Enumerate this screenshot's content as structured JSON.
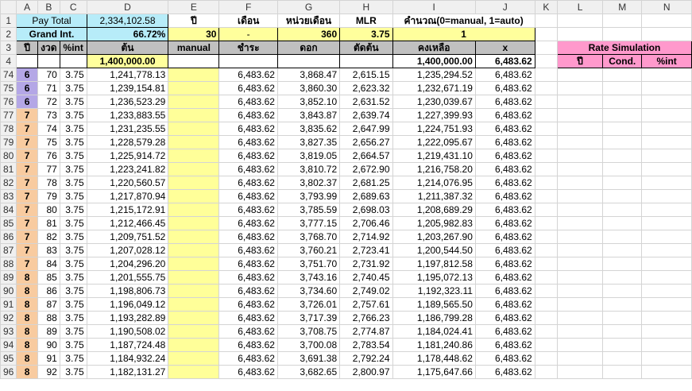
{
  "columns": [
    "A",
    "B",
    "C",
    "D",
    "E",
    "F",
    "G",
    "H",
    "I",
    "J",
    "K",
    "L",
    "M",
    "N"
  ],
  "row1": {
    "rn": "1",
    "pay_total_label": "Pay Total",
    "pay_total": "2,334,102.58",
    "e_label": "ปี",
    "f_label": "เดือน",
    "g_label": "หน่วยเดือน",
    "h_label": "MLR",
    "i_label": "คำนวณ(0=manual, 1=auto)"
  },
  "row2": {
    "rn": "2",
    "grand_int_label": "Grand Int.",
    "grand_int": "66.72%",
    "years": "30",
    "f_value": "-",
    "months": "360",
    "mlr": "3.75",
    "mode": "1"
  },
  "row3": {
    "rn": "3",
    "year": "ปี",
    "period": "งวด",
    "pint": "%int",
    "principal": "ต้น",
    "manual": "manual",
    "payment": "ชำระ",
    "interest": "ดอก",
    "deduct": "ตัดต้น",
    "balance": "คงเหลือ",
    "x": "x",
    "rate_sim": "Rate Simulation"
  },
  "row4": {
    "rn": "4",
    "principal": "1,400,000.00",
    "balance": "1,400,000.00",
    "x": "6,483.62",
    "sim_year": "ปี",
    "sim_cond": "Cond.",
    "sim_pint": "%int",
    "sim_pay": "ชำระ"
  },
  "rows": [
    {
      "rn": "74",
      "y": "6",
      "p": "70",
      "i": "3.75",
      "d": "1,241,778.13",
      "f": "6,483.62",
      "g": "3,868.47",
      "h": "2,615.15",
      "bal": "1,235,294.52",
      "x": "6,483.62"
    },
    {
      "rn": "75",
      "y": "6",
      "p": "71",
      "i": "3.75",
      "d": "1,239,154.81",
      "f": "6,483.62",
      "g": "3,860.30",
      "h": "2,623.32",
      "bal": "1,232,671.19",
      "x": "6,483.62"
    },
    {
      "rn": "76",
      "y": "6",
      "p": "72",
      "i": "3.75",
      "d": "1,236,523.29",
      "f": "6,483.62",
      "g": "3,852.10",
      "h": "2,631.52",
      "bal": "1,230,039.67",
      "x": "6,483.62"
    },
    {
      "rn": "77",
      "y": "7",
      "p": "73",
      "i": "3.75",
      "d": "1,233,883.55",
      "f": "6,483.62",
      "g": "3,843.87",
      "h": "2,639.74",
      "bal": "1,227,399.93",
      "x": "6,483.62"
    },
    {
      "rn": "78",
      "y": "7",
      "p": "74",
      "i": "3.75",
      "d": "1,231,235.55",
      "f": "6,483.62",
      "g": "3,835.62",
      "h": "2,647.99",
      "bal": "1,224,751.93",
      "x": "6,483.62"
    },
    {
      "rn": "79",
      "y": "7",
      "p": "75",
      "i": "3.75",
      "d": "1,228,579.28",
      "f": "6,483.62",
      "g": "3,827.35",
      "h": "2,656.27",
      "bal": "1,222,095.67",
      "x": "6,483.62"
    },
    {
      "rn": "80",
      "y": "7",
      "p": "76",
      "i": "3.75",
      "d": "1,225,914.72",
      "f": "6,483.62",
      "g": "3,819.05",
      "h": "2,664.57",
      "bal": "1,219,431.10",
      "x": "6,483.62"
    },
    {
      "rn": "81",
      "y": "7",
      "p": "77",
      "i": "3.75",
      "d": "1,223,241.82",
      "f": "6,483.62",
      "g": "3,810.72",
      "h": "2,672.90",
      "bal": "1,216,758.20",
      "x": "6,483.62"
    },
    {
      "rn": "82",
      "y": "7",
      "p": "78",
      "i": "3.75",
      "d": "1,220,560.57",
      "f": "6,483.62",
      "g": "3,802.37",
      "h": "2,681.25",
      "bal": "1,214,076.95",
      "x": "6,483.62"
    },
    {
      "rn": "83",
      "y": "7",
      "p": "79",
      "i": "3.75",
      "d": "1,217,870.94",
      "f": "6,483.62",
      "g": "3,793.99",
      "h": "2,689.63",
      "bal": "1,211,387.32",
      "x": "6,483.62"
    },
    {
      "rn": "84",
      "y": "7",
      "p": "80",
      "i": "3.75",
      "d": "1,215,172.91",
      "f": "6,483.62",
      "g": "3,785.59",
      "h": "2,698.03",
      "bal": "1,208,689.29",
      "x": "6,483.62"
    },
    {
      "rn": "85",
      "y": "7",
      "p": "81",
      "i": "3.75",
      "d": "1,212,466.45",
      "f": "6,483.62",
      "g": "3,777.15",
      "h": "2,706.46",
      "bal": "1,205,982.83",
      "x": "6,483.62"
    },
    {
      "rn": "86",
      "y": "7",
      "p": "82",
      "i": "3.75",
      "d": "1,209,751.52",
      "f": "6,483.62",
      "g": "3,768.70",
      "h": "2,714.92",
      "bal": "1,203,267.90",
      "x": "6,483.62"
    },
    {
      "rn": "87",
      "y": "7",
      "p": "83",
      "i": "3.75",
      "d": "1,207,028.12",
      "f": "6,483.62",
      "g": "3,760.21",
      "h": "2,723.41",
      "bal": "1,200,544.50",
      "x": "6,483.62"
    },
    {
      "rn": "88",
      "y": "7",
      "p": "84",
      "i": "3.75",
      "d": "1,204,296.20",
      "f": "6,483.62",
      "g": "3,751.70",
      "h": "2,731.92",
      "bal": "1,197,812.58",
      "x": "6,483.62"
    },
    {
      "rn": "89",
      "y": "8",
      "p": "85",
      "i": "3.75",
      "d": "1,201,555.75",
      "f": "6,483.62",
      "g": "3,743.16",
      "h": "2,740.45",
      "bal": "1,195,072.13",
      "x": "6,483.62"
    },
    {
      "rn": "90",
      "y": "8",
      "p": "86",
      "i": "3.75",
      "d": "1,198,806.73",
      "f": "6,483.62",
      "g": "3,734.60",
      "h": "2,749.02",
      "bal": "1,192,323.11",
      "x": "6,483.62"
    },
    {
      "rn": "91",
      "y": "8",
      "p": "87",
      "i": "3.75",
      "d": "1,196,049.12",
      "f": "6,483.62",
      "g": "3,726.01",
      "h": "2,757.61",
      "bal": "1,189,565.50",
      "x": "6,483.62"
    },
    {
      "rn": "92",
      "y": "8",
      "p": "88",
      "i": "3.75",
      "d": "1,193,282.89",
      "f": "6,483.62",
      "g": "3,717.39",
      "h": "2,766.23",
      "bal": "1,186,799.28",
      "x": "6,483.62"
    },
    {
      "rn": "93",
      "y": "8",
      "p": "89",
      "i": "3.75",
      "d": "1,190,508.02",
      "f": "6,483.62",
      "g": "3,708.75",
      "h": "2,774.87",
      "bal": "1,184,024.41",
      "x": "6,483.62"
    },
    {
      "rn": "94",
      "y": "8",
      "p": "90",
      "i": "3.75",
      "d": "1,187,724.48",
      "f": "6,483.62",
      "g": "3,700.08",
      "h": "2,783.54",
      "bal": "1,181,240.86",
      "x": "6,483.62"
    },
    {
      "rn": "95",
      "y": "8",
      "p": "91",
      "i": "3.75",
      "d": "1,184,932.24",
      "f": "6,483.62",
      "g": "3,691.38",
      "h": "2,792.24",
      "bal": "1,178,448.62",
      "x": "6,483.62"
    },
    {
      "rn": "96",
      "y": "8",
      "p": "92",
      "i": "3.75",
      "d": "1,182,131.27",
      "f": "6,483.62",
      "g": "3,682.65",
      "h": "2,800.97",
      "bal": "1,175,647.66",
      "x": "6,483.62"
    }
  ],
  "colors": {
    "cyan": "#b7ecf9",
    "yellow": "#ffff9c",
    "pink": "#ff99cc",
    "purple": "#b4a7e6",
    "orange": "#f8cba0",
    "gray": "#c0c0c0"
  }
}
